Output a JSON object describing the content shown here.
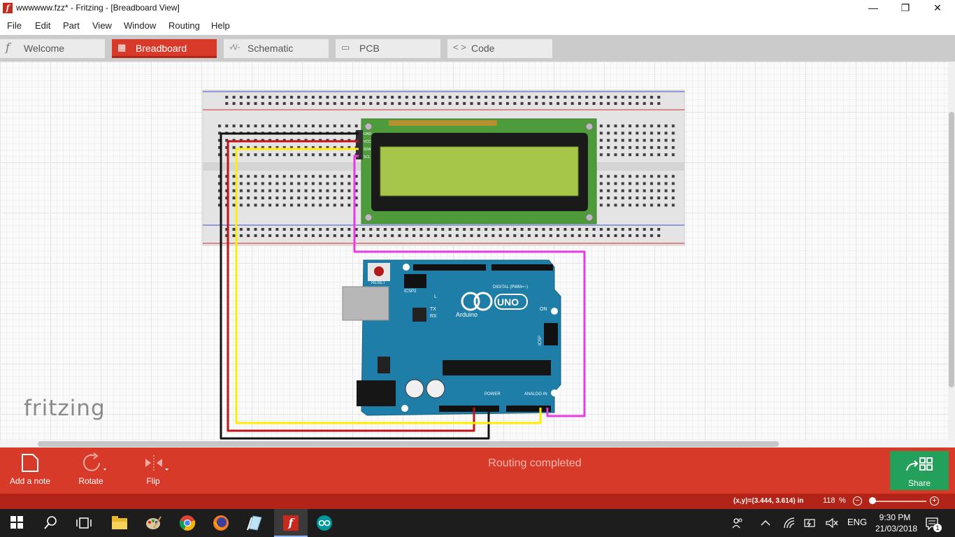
{
  "window": {
    "title": "wwwwww.fzz* - Fritzing - [Breadboard View]",
    "minimize": "—",
    "maximize": "❐",
    "close": "✕"
  },
  "menu": [
    "File",
    "Edit",
    "Part",
    "View",
    "Window",
    "Routing",
    "Help"
  ],
  "tabs": [
    {
      "label": "Welcome",
      "icon": "fritzing-f-icon",
      "glyph": "f",
      "active": false
    },
    {
      "label": "Breadboard",
      "icon": "breadboard-icon",
      "glyph": "▦",
      "active": true
    },
    {
      "label": "Schematic",
      "icon": "resistor-icon",
      "glyph": "-⁄\\/-",
      "active": false
    },
    {
      "label": "PCB",
      "icon": "pcb-icon",
      "glyph": "▭",
      "active": false
    },
    {
      "label": "Code",
      "icon": "code-icon",
      "glyph": "< >",
      "active": false
    }
  ],
  "canvas": {
    "watermark": "fritzing",
    "lcd_pins": [
      "GND",
      "VCC",
      "SDA",
      "SCL"
    ],
    "arduino": {
      "reset_label": "RESET",
      "icsp2_label": "ICSP2",
      "icsp_label": "ICSP",
      "digital_label": "DIGITAL (PWM=~)",
      "brand": "Arduino",
      "model": "UNO",
      "led_l": "L",
      "led_tx": "TX",
      "led_rx": "RX",
      "led_on": "ON",
      "power_label": "POWER",
      "analog_label": "ANALOG IN"
    },
    "wire_colors": {
      "black": "#111111",
      "red": "#c0141a",
      "yellow": "#ffee00",
      "magenta": "#e83ce0"
    }
  },
  "toolbar": {
    "add_note": "Add a note",
    "rotate": "Rotate",
    "flip": "Flip",
    "status_message": "Routing completed",
    "share": "Share"
  },
  "statusbar": {
    "coords": "(x,y)=(3.444, 3.614) in",
    "zoom": "118",
    "zoom_unit": "%",
    "zoom_level": 0.05
  },
  "taskbar": {
    "language": "ENG",
    "time": "9:30 PM",
    "date": "21/03/2018",
    "notifications": "1"
  },
  "colors": {
    "accent": "#d83a2a",
    "accent_dark": "#b22417",
    "share_green": "#23a05a",
    "breadboard": "#e4e4e4",
    "lcd_pcb": "#4d9b3a",
    "lcd_screen": "#a6c64a",
    "arduino": "#1f7ea8"
  }
}
